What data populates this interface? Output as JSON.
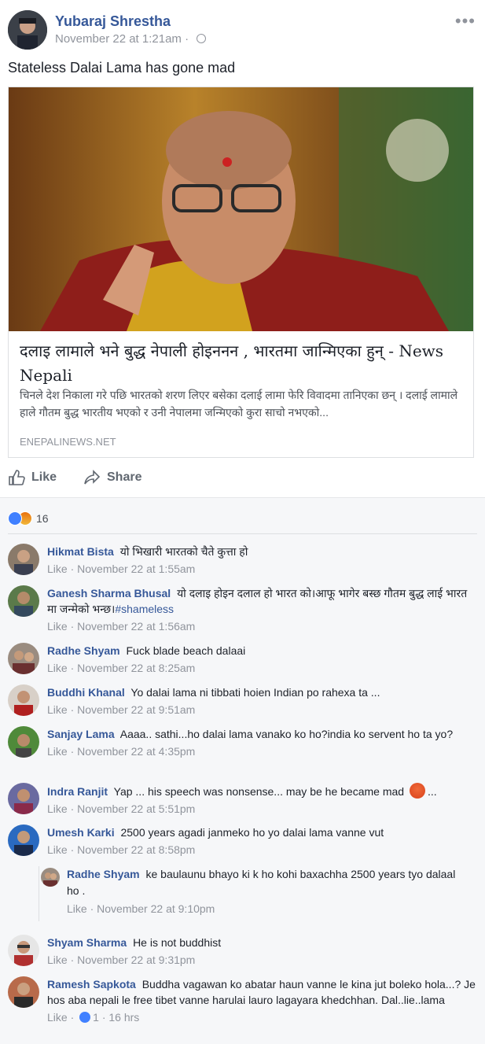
{
  "post": {
    "author": "Yubaraj Shrestha",
    "timestamp": "November 22 at 1:21am",
    "text": "Stateless Dalai Lama has gone mad",
    "more_icon": "more-dots-icon",
    "privacy_icon": "globe-icon"
  },
  "link": {
    "title": "दलाइ लामाले भने बुद्ध नेपाली होइननन , भारतमा जान्मिएका हुन् - News Nepali",
    "description": "चिनले देश निकाला गरे पछि भारतको शरण लिएर बसेका दलाई लामा फेरि विवादमा तानिएका छन् । दलाई लामाले हाले गौतम बुद्ध भारतीय भएको र उनी नेपालमा जन्मिएको कुरा साचो नभएको...",
    "domain": "ENEPALINEWS.NET"
  },
  "actions": {
    "like": "Like",
    "share": "Share"
  },
  "reactions": {
    "count": "16"
  },
  "comments": [
    {
      "name": "Hikmat Bista",
      "text": "यो भिखारी भारतको चैते कुत्ता हो",
      "like": "Like",
      "time": "November 22 at 1:55am"
    },
    {
      "name": "Ganesh Sharma Bhusal",
      "text": "यो दलाइ होइन दलाल हो भारत को।आफू भागेर बस्छ गौतम बुद्ध लाई भारत मा जन्मेको भन्छ।",
      "tag": "#shameless",
      "like": "Like",
      "time": "November 22 at 1:56am"
    },
    {
      "name": "Radhe Shyam",
      "text": "Fuck blade beach dalaai",
      "like": "Like",
      "time": "November 22 at 8:25am"
    },
    {
      "name": "Buddhi Khanal",
      "text": "Yo dalai lama ni tibbati hoien Indian po rahexa ta ...",
      "like": "Like",
      "time": "November 22 at 9:51am"
    },
    {
      "name": "Sanjay Lama",
      "text": "Aaaa.. sathi...ho dalai lama vanako ko ho?india ko servent ho ta yo?",
      "like": "Like",
      "time": "November 22 at 4:35pm"
    },
    {
      "name": "Indra Ranjit",
      "text": "Yap ... his speech was nonsense... may be he became mad",
      "trail": "...",
      "like": "Like",
      "time": "November 22 at 5:51pm"
    },
    {
      "name": "Umesh Karki",
      "text": "2500 years agadi janmeko ho yo dalai lama vanne vut",
      "like": "Like",
      "time": "November 22 at 8:58pm"
    },
    {
      "name": "Shyam Sharma",
      "text": "He is not buddhist",
      "like": "Like",
      "time": "November 22 at 9:31pm"
    },
    {
      "name": "Ramesh Sapkota",
      "text": "Buddha vagawan ko abatar haun vanne le kina jut boleko hola...? Je hos aba nepali le free tibet vanne harulai lauro lagayara khedchhan. Dal..lie..lama",
      "like": "Like",
      "like_count": "1",
      "time": "16 hrs"
    }
  ],
  "reply": {
    "name": "Radhe Shyam",
    "text": "ke baulaunu bhayo ki k ho kohi baxachha 2500 years tyo dalaal ho .",
    "like": "Like",
    "time": "November 22 at 9:10pm"
  },
  "meta_sep": "·"
}
